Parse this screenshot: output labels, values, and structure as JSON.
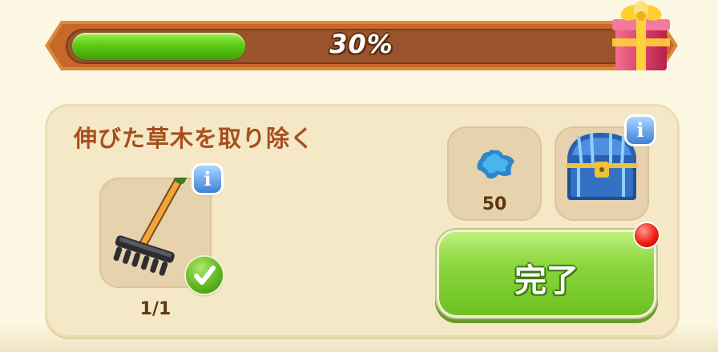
{
  "progress": {
    "value": 0.3,
    "label": "30%"
  },
  "task": {
    "title": "伸びた草木を取り除く",
    "tool": {
      "icon": "rake-icon",
      "count": "1/1",
      "completed": true
    },
    "rewards": [
      {
        "icon": "blue-star-gem-icon",
        "amount": "50"
      },
      {
        "icon": "treasure-chest-icon"
      }
    ],
    "complete_label": "完了"
  },
  "colors": {
    "bar_frame": "#c9702a",
    "bar_track": "#7c3e1a",
    "bar_fill": "#5ccb14",
    "button_green": "#8bd63d",
    "title_brown": "#a8501d",
    "notify_red": "#f21d12"
  }
}
